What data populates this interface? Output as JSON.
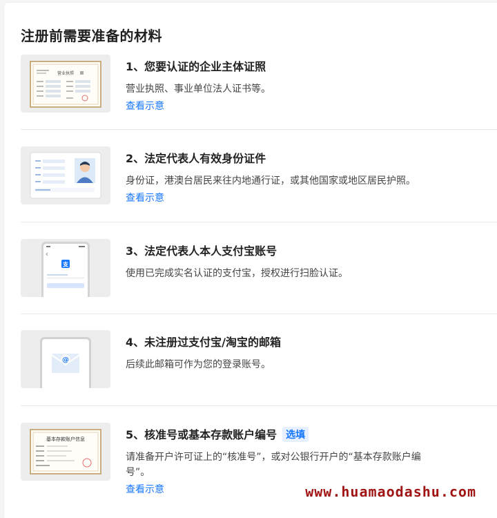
{
  "page": {
    "title": "注册前需要准备的材料"
  },
  "items": [
    {
      "title": "1、您要认证的企业主体证照",
      "desc": "营业执照、事业单位法人证书等。",
      "link": "查看示意",
      "thumb": {
        "kind": "license",
        "doc_title": "营业执照"
      }
    },
    {
      "title": "2、法定代表人有效身份证件",
      "desc": "身份证，港澳台居民来往内地通行证，或其他国家或地区居民护照。",
      "link": "查看示意",
      "thumb": {
        "kind": "id-card"
      }
    },
    {
      "title": "3、法定代表人本人支付宝账号",
      "desc": "使用已完成实名认证的支付宝，授权进行扫脸认证。",
      "thumb": {
        "kind": "phone-alipay",
        "app_glyph": "支"
      }
    },
    {
      "title": "4、未注册过支付宝/淘宝的邮箱",
      "desc": "后续此邮箱可作为您的登录账号。",
      "thumb": {
        "kind": "email"
      }
    },
    {
      "title": "5、核准号或基本存款账户编号",
      "tag": "选填",
      "desc": "请准备开户许可证上的“核准号”，或对公银行开户的“基本存款账户编号”。",
      "link": "查看示意",
      "thumb": {
        "kind": "bank-certificate",
        "doc_title": "基本存款账户信息"
      }
    }
  ],
  "watermark": "www.huamaodashu.com",
  "colors": {
    "link": "#1677ff",
    "tag_bg": "#e6f0ff",
    "watermark": "#a01414",
    "thumb_bg": "#ededed"
  }
}
